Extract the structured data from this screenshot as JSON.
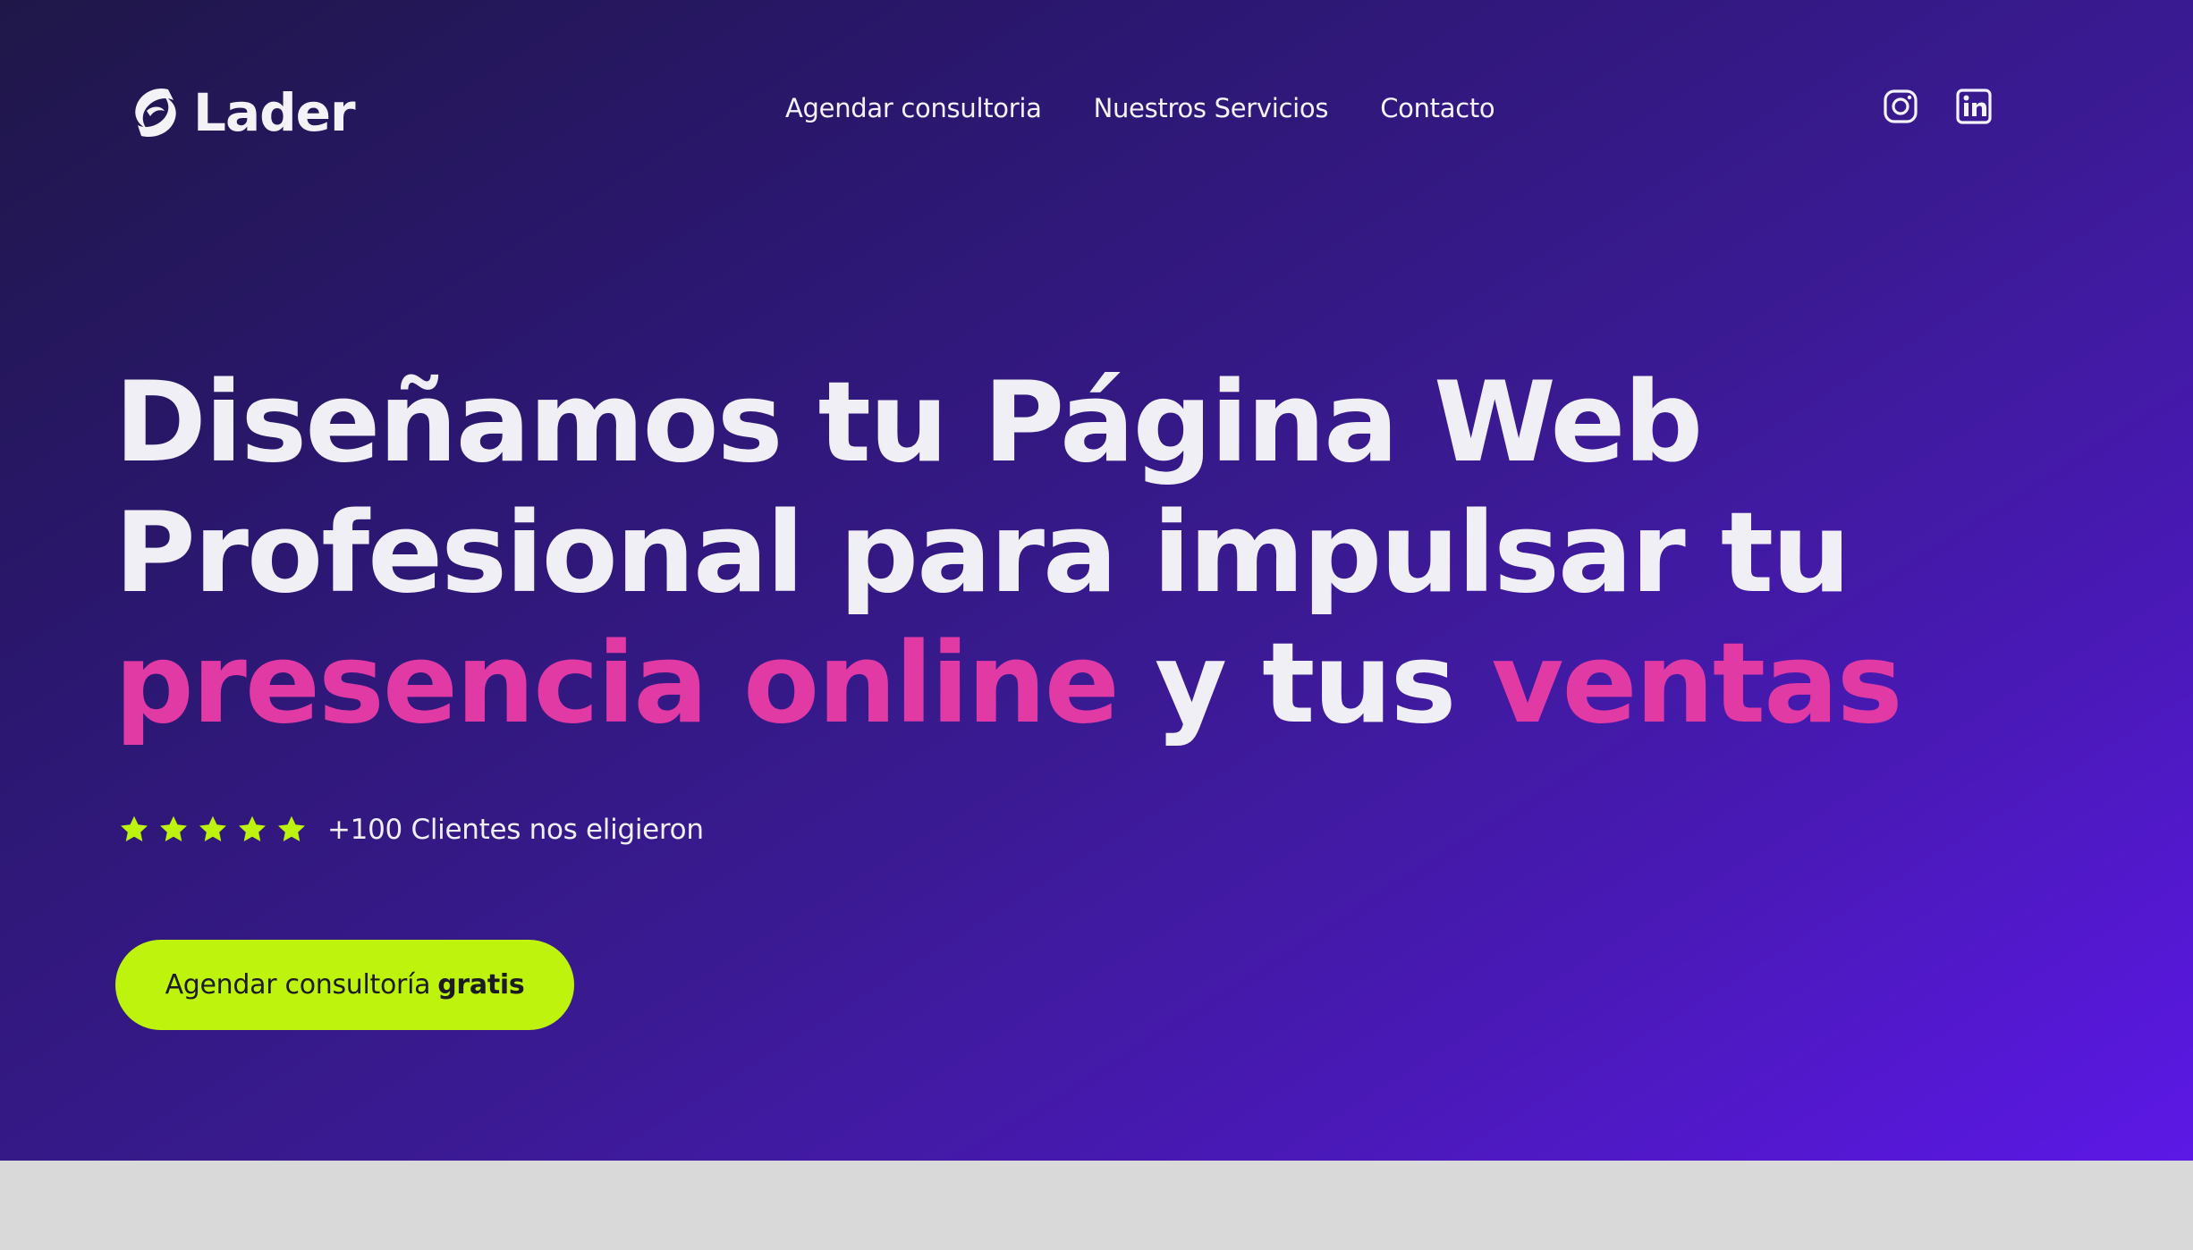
{
  "brand": {
    "name": "Lader",
    "logo_icon": "lader-swirl-logo-icon"
  },
  "nav": {
    "items": [
      {
        "label": "Agendar consultoria"
      },
      {
        "label": "Nuestros Servicios"
      },
      {
        "label": "Contacto"
      }
    ]
  },
  "social": {
    "icons": [
      "instagram-icon",
      "linkedin-icon"
    ]
  },
  "hero": {
    "headline_line1": "Diseñamos tu Página Web",
    "headline_line2": "Profesional para impulsar tu",
    "headline_line3_pink1": "presencia online",
    "headline_line3_mid": " y tus ",
    "headline_line3_pink2": "ventas",
    "rating": {
      "stars": 5,
      "text": "+100 Clientes nos eligieron"
    },
    "cta": {
      "label_regular": "Agendar consultoría",
      "label_bold": "gratis"
    }
  },
  "colors": {
    "accent_pink": "#e23aa4",
    "accent_lime": "#bdf30d",
    "bg_gradient_start": "#1f1748",
    "bg_gradient_end": "#5c18e6",
    "text_light": "#f1eff6"
  }
}
